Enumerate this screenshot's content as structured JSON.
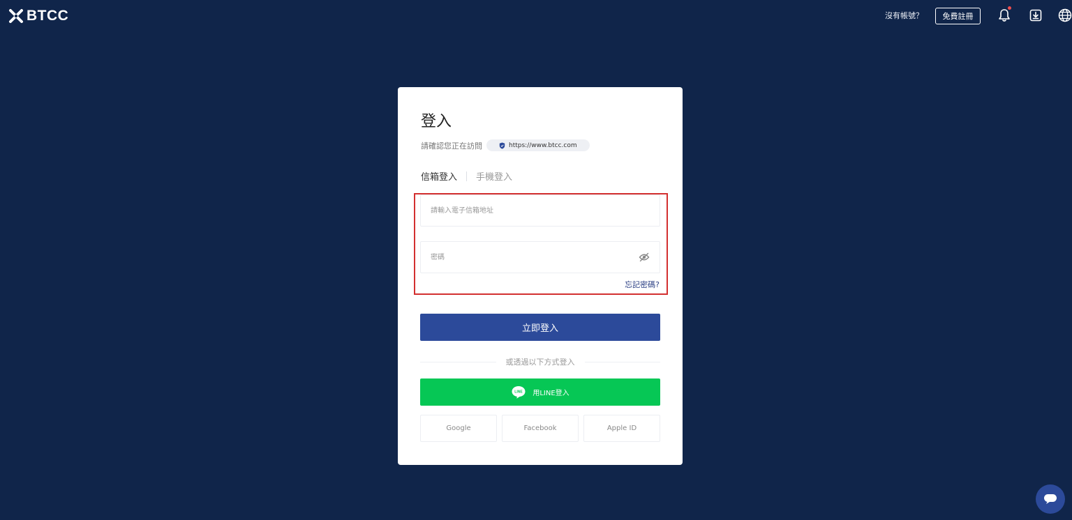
{
  "header": {
    "logo_text": "BTCC",
    "no_account": "沒有帳號？",
    "register_label": "免費註冊"
  },
  "login": {
    "title": "登入",
    "verify_text": "請確認您正在訪問",
    "url": "https://www.btcc.com",
    "tabs": [
      {
        "label": "信箱登入",
        "active": true
      },
      {
        "label": "手機登入",
        "active": false
      }
    ],
    "email_placeholder": "請輸入電子信箱地址",
    "password_placeholder": "密碼",
    "forgot_label": "忘記密碼?",
    "submit_label": "立即登入",
    "divider_text": "或透過以下方式登入",
    "line_label": "用LINE登入",
    "line_logo_text": "LINE",
    "social": [
      {
        "label": "Google"
      },
      {
        "label": "Facebook"
      },
      {
        "label": "Apple ID"
      }
    ]
  },
  "colors": {
    "background": "#10254a",
    "primary": "#2c4a9a",
    "line_green": "#06c755",
    "highlight": "#d32f2f"
  }
}
